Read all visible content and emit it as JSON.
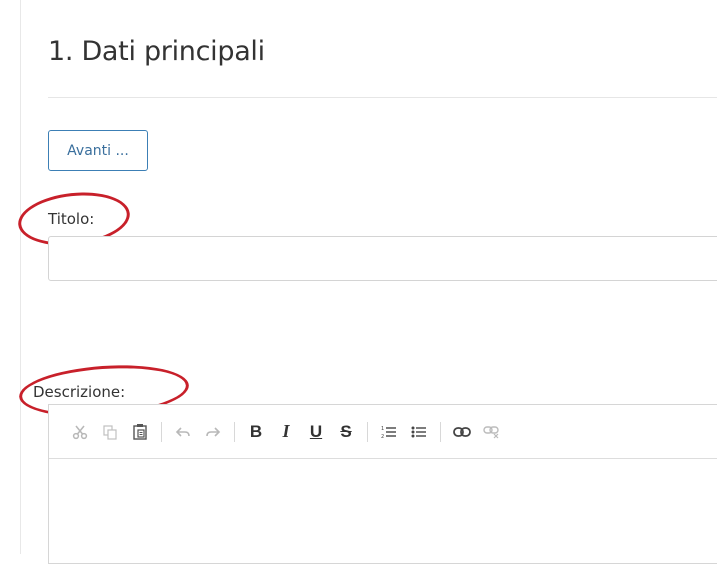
{
  "page": {
    "title": "1. Dati principali"
  },
  "actions": {
    "next_label": "Avanti ..."
  },
  "form": {
    "title_label": "Titolo:",
    "title_value": "",
    "description_label": "Descrizione:"
  },
  "annotation": {
    "color": "#c8202a"
  },
  "toolbar": {
    "items": [
      {
        "icon": "cut-icon",
        "state": "disabled"
      },
      {
        "icon": "copy-icon",
        "state": "disabled"
      },
      {
        "icon": "paste-icon",
        "state": "enabled"
      },
      {
        "icon": "undo-icon",
        "state": "disabled"
      },
      {
        "icon": "redo-icon",
        "state": "disabled"
      },
      {
        "icon": "bold-icon",
        "glyph": "B",
        "state": "enabled"
      },
      {
        "icon": "italic-icon",
        "glyph": "I",
        "state": "enabled"
      },
      {
        "icon": "underline-icon",
        "glyph": "U",
        "state": "enabled"
      },
      {
        "icon": "strikethrough-icon",
        "glyph": "S",
        "state": "enabled"
      },
      {
        "icon": "numbered-list-icon",
        "state": "enabled"
      },
      {
        "icon": "bulleted-list-icon",
        "state": "enabled"
      },
      {
        "icon": "link-icon",
        "state": "enabled"
      },
      {
        "icon": "unlink-icon",
        "state": "disabled"
      }
    ]
  }
}
